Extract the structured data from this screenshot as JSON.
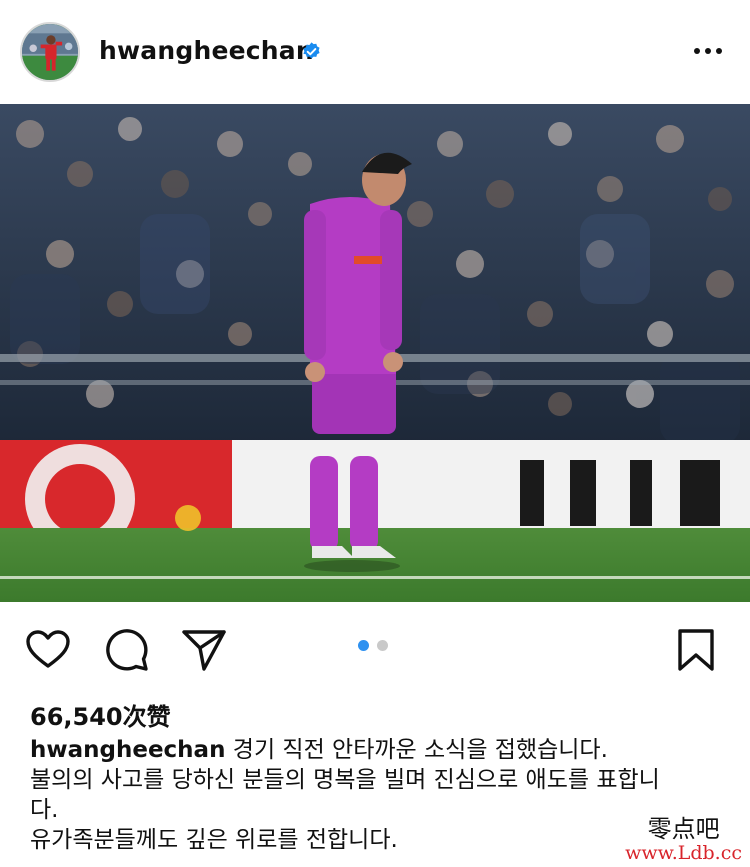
{
  "post": {
    "username": "hwangheechan",
    "verified": true,
    "avatar_icon": "profile-photo-footballer",
    "more_icon": "more-horizontal-icon"
  },
  "media": {
    "description": "footballer-in-purple-kit-head-bowed",
    "carousel_count": 2,
    "carousel_active": 1
  },
  "actions": {
    "like_icon": "heart-icon",
    "comment_icon": "comment-bubble-icon",
    "share_icon": "send-paper-plane-icon",
    "save_icon": "bookmark-icon"
  },
  "likes": {
    "text": "66,540次赞"
  },
  "caption": {
    "username": "hwangheechan",
    "line1": "경기 직전 안타까운 소식을 접했습니다.",
    "line2": "불의의 사고를 당하신 분들의 명복을 빌며 진심으로 애도를 표합니",
    "line3": "다.",
    "line4": "유가족분들께도 깊은 위로를 전합니다."
  },
  "watermark": {
    "text": "零点吧",
    "url": "www.Ldb.cc"
  },
  "colors": {
    "accent_blue": "#2e91f0",
    "kit_purple": "#b43cc4",
    "verified_blue": "#1a8cf0"
  }
}
